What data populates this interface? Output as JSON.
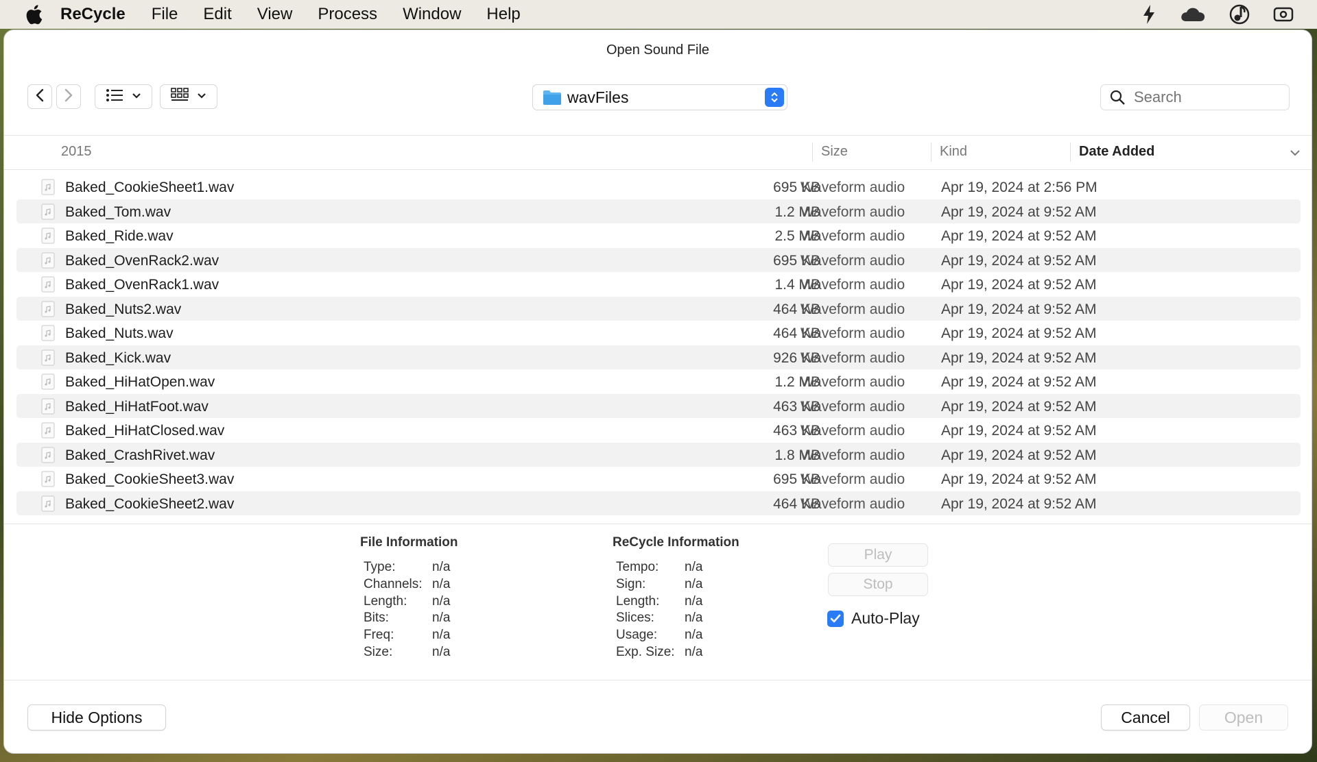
{
  "menubar": {
    "app": "ReCycle",
    "items": [
      "File",
      "Edit",
      "View",
      "Process",
      "Window",
      "Help"
    ],
    "status_icons": [
      "bolt-icon",
      "cloud-icon",
      "music-note-icon",
      "camera-icon"
    ]
  },
  "dialog": {
    "title": "Open Sound File",
    "location": "wavFiles",
    "search_placeholder": "Search"
  },
  "columns": {
    "group": "2015",
    "size": "Size",
    "kind": "Kind",
    "date": "Date Added"
  },
  "files": [
    {
      "name": "Baked_CookieSheet1.wav",
      "size": "695 KB",
      "kind": "Waveform audio",
      "date": "Apr 19, 2024 at 2:56 PM"
    },
    {
      "name": "Baked_Tom.wav",
      "size": "1.2 MB",
      "kind": "Waveform audio",
      "date": "Apr 19, 2024 at 9:52 AM"
    },
    {
      "name": "Baked_Ride.wav",
      "size": "2.5 MB",
      "kind": "Waveform audio",
      "date": "Apr 19, 2024 at 9:52 AM"
    },
    {
      "name": "Baked_OvenRack2.wav",
      "size": "695 KB",
      "kind": "Waveform audio",
      "date": "Apr 19, 2024 at 9:52 AM"
    },
    {
      "name": "Baked_OvenRack1.wav",
      "size": "1.4 MB",
      "kind": "Waveform audio",
      "date": "Apr 19, 2024 at 9:52 AM"
    },
    {
      "name": "Baked_Nuts2.wav",
      "size": "464 KB",
      "kind": "Waveform audio",
      "date": "Apr 19, 2024 at 9:52 AM"
    },
    {
      "name": "Baked_Nuts.wav",
      "size": "464 KB",
      "kind": "Waveform audio",
      "date": "Apr 19, 2024 at 9:52 AM"
    },
    {
      "name": "Baked_Kick.wav",
      "size": "926 KB",
      "kind": "Waveform audio",
      "date": "Apr 19, 2024 at 9:52 AM"
    },
    {
      "name": "Baked_HiHatOpen.wav",
      "size": "1.2 MB",
      "kind": "Waveform audio",
      "date": "Apr 19, 2024 at 9:52 AM"
    },
    {
      "name": "Baked_HiHatFoot.wav",
      "size": "463 KB",
      "kind": "Waveform audio",
      "date": "Apr 19, 2024 at 9:52 AM"
    },
    {
      "name": "Baked_HiHatClosed.wav",
      "size": "463 KB",
      "kind": "Waveform audio",
      "date": "Apr 19, 2024 at 9:52 AM"
    },
    {
      "name": "Baked_CrashRivet.wav",
      "size": "1.8 MB",
      "kind": "Waveform audio",
      "date": "Apr 19, 2024 at 9:52 AM"
    },
    {
      "name": "Baked_CookieSheet3.wav",
      "size": "695 KB",
      "kind": "Waveform audio",
      "date": "Apr 19, 2024 at 9:52 AM"
    },
    {
      "name": "Baked_CookieSheet2.wav",
      "size": "464 KB",
      "kind": "Waveform audio",
      "date": "Apr 19, 2024 at 9:52 AM"
    }
  ],
  "file_info": {
    "title": "File Information",
    "rows": [
      {
        "k": "Type:",
        "v": "n/a"
      },
      {
        "k": "Channels:",
        "v": "n/a"
      },
      {
        "k": "Length:",
        "v": "n/a"
      },
      {
        "k": "Bits:",
        "v": "n/a"
      },
      {
        "k": "Freq:",
        "v": "n/a"
      },
      {
        "k": "Size:",
        "v": "n/a"
      }
    ]
  },
  "recycle_info": {
    "title": "ReCycle Information",
    "rows": [
      {
        "k": "Tempo:",
        "v": "n/a"
      },
      {
        "k": "Sign:",
        "v": "n/a"
      },
      {
        "k": "Length:",
        "v": "n/a"
      },
      {
        "k": "Slices:",
        "v": "n/a"
      },
      {
        "k": "Usage:",
        "v": "n/a"
      },
      {
        "k": "Exp. Size:",
        "v": "n/a"
      }
    ]
  },
  "playback": {
    "play": "Play",
    "stop": "Stop",
    "autoplay_label": "Auto-Play",
    "autoplay_checked": true
  },
  "buttons": {
    "hide_options": "Hide Options",
    "cancel": "Cancel",
    "open": "Open"
  }
}
